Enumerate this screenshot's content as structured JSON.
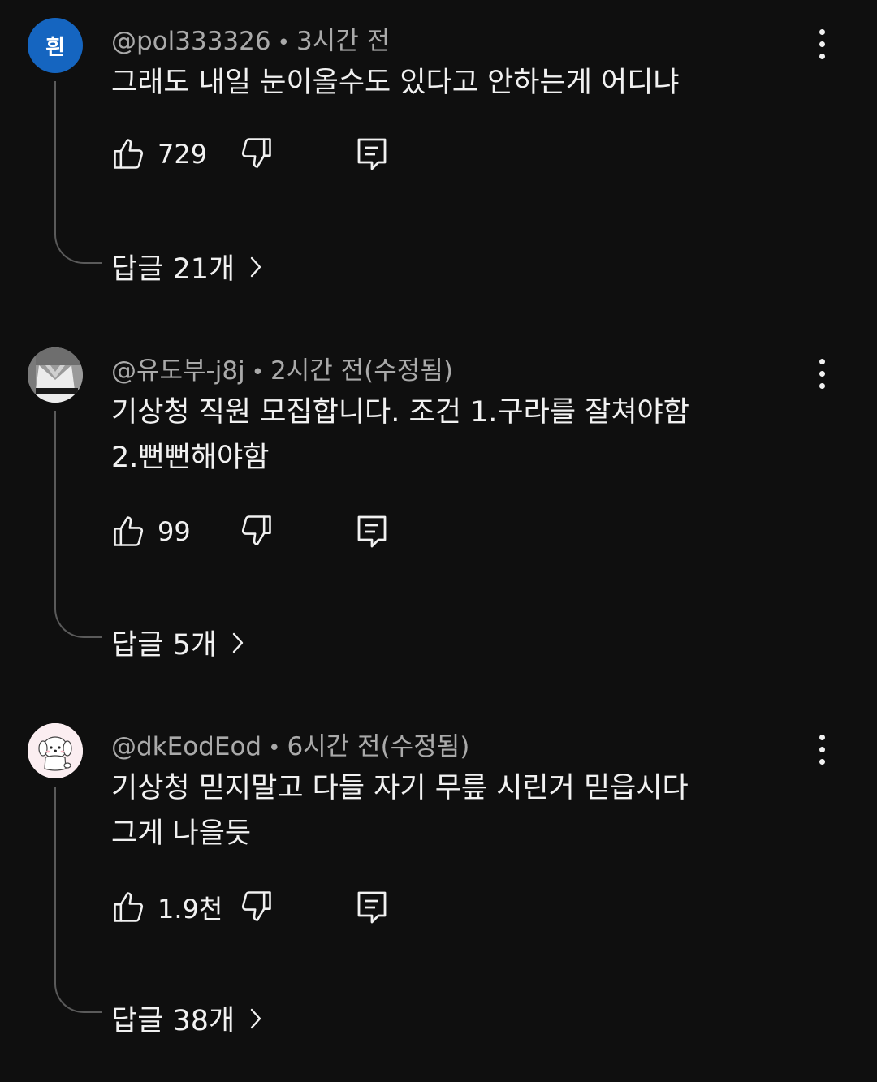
{
  "comments": [
    {
      "avatar_letter": "흰",
      "author": "@pol333326",
      "time": "3시간 전",
      "text": "그래도 내일 눈이올수도 있다고 안하는게 어디냐",
      "likes": "729",
      "replies_label": "답글 21개"
    },
    {
      "author": "@유도부-j8j",
      "time": "2시간 전(수정됨)",
      "text": "기상청 직원 모집합니다. 조건  1.구라를 잘쳐야함 2.뻔뻔해야함",
      "likes": "99",
      "replies_label": "답글 5개"
    },
    {
      "author": "@dkEodEod",
      "time": "6시간 전(수정됨)",
      "text": "기상청 믿지말고 다들 자기 무릎 시린거 믿읍시다 그게 나을듯",
      "likes": "1.9천",
      "replies_label": "답글 38개"
    }
  ],
  "icons": {
    "like": "thumb-up-icon",
    "dislike": "thumb-down-icon",
    "reply": "comment-icon",
    "menu": "more-vertical-icon",
    "chevron": "chevron-right-icon"
  },
  "colors": {
    "background": "#0f0f0f",
    "text": "#f1f1f1",
    "secondary_text": "#aaaaaa",
    "avatar_blue": "#1565c0"
  }
}
